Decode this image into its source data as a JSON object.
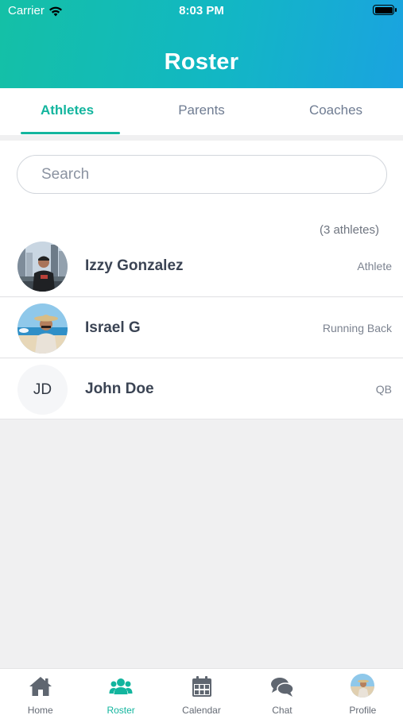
{
  "status_bar": {
    "carrier": "Carrier",
    "time": "8:03 PM"
  },
  "header": {
    "title": "Roster"
  },
  "tabs": [
    {
      "label": "Athletes",
      "active": true
    },
    {
      "label": "Parents",
      "active": false
    },
    {
      "label": "Coaches",
      "active": false
    }
  ],
  "search": {
    "placeholder": "Search",
    "value": ""
  },
  "athlete_count": "(3 athletes)",
  "athletes": [
    {
      "name": "Izzy Gonzalez",
      "role": "Athlete",
      "avatar": "photo-city"
    },
    {
      "name": "Israel G",
      "role": "Running Back",
      "avatar": "photo-beach"
    },
    {
      "name": "John Doe",
      "role": "QB",
      "initials": "JD"
    }
  ],
  "tab_bar": [
    {
      "label": "Home",
      "icon": "home-icon"
    },
    {
      "label": "Roster",
      "icon": "users-icon",
      "active": true
    },
    {
      "label": "Calendar",
      "icon": "calendar-icon"
    },
    {
      "label": "Chat",
      "icon": "chat-icon"
    },
    {
      "label": "Profile",
      "icon": "profile-avatar"
    }
  ],
  "colors": {
    "accent": "#13b59e",
    "header_start": "#14c0a6",
    "header_end": "#1aa3e0",
    "inactive": "#6f7c92"
  }
}
